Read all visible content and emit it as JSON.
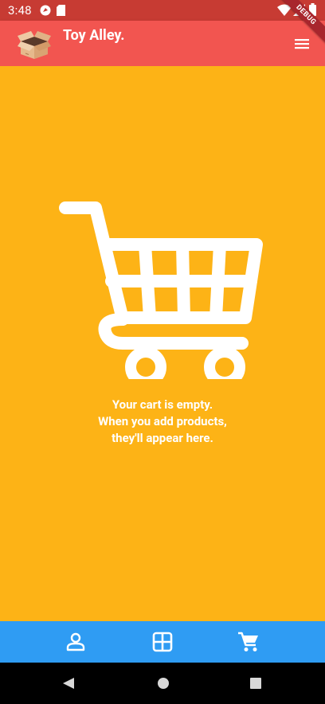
{
  "status_bar": {
    "time": "3:48"
  },
  "app_bar": {
    "title": "Toy Alley.",
    "debug_label": "DEBUG"
  },
  "cart": {
    "message_lines": [
      "Your cart is empty.",
      "When you add products,",
      "they'll appear here."
    ]
  },
  "bottom_nav": {
    "items": [
      {
        "name": "profile",
        "icon": "person-icon"
      },
      {
        "name": "categories",
        "icon": "grid-icon"
      },
      {
        "name": "cart",
        "icon": "cart-icon"
      }
    ]
  },
  "colors": {
    "status_bar": "#c73b33",
    "app_bar": "#f25550",
    "background": "#fdb316",
    "bottom_nav": "#2f9cf3",
    "icon": "#ffffff"
  }
}
